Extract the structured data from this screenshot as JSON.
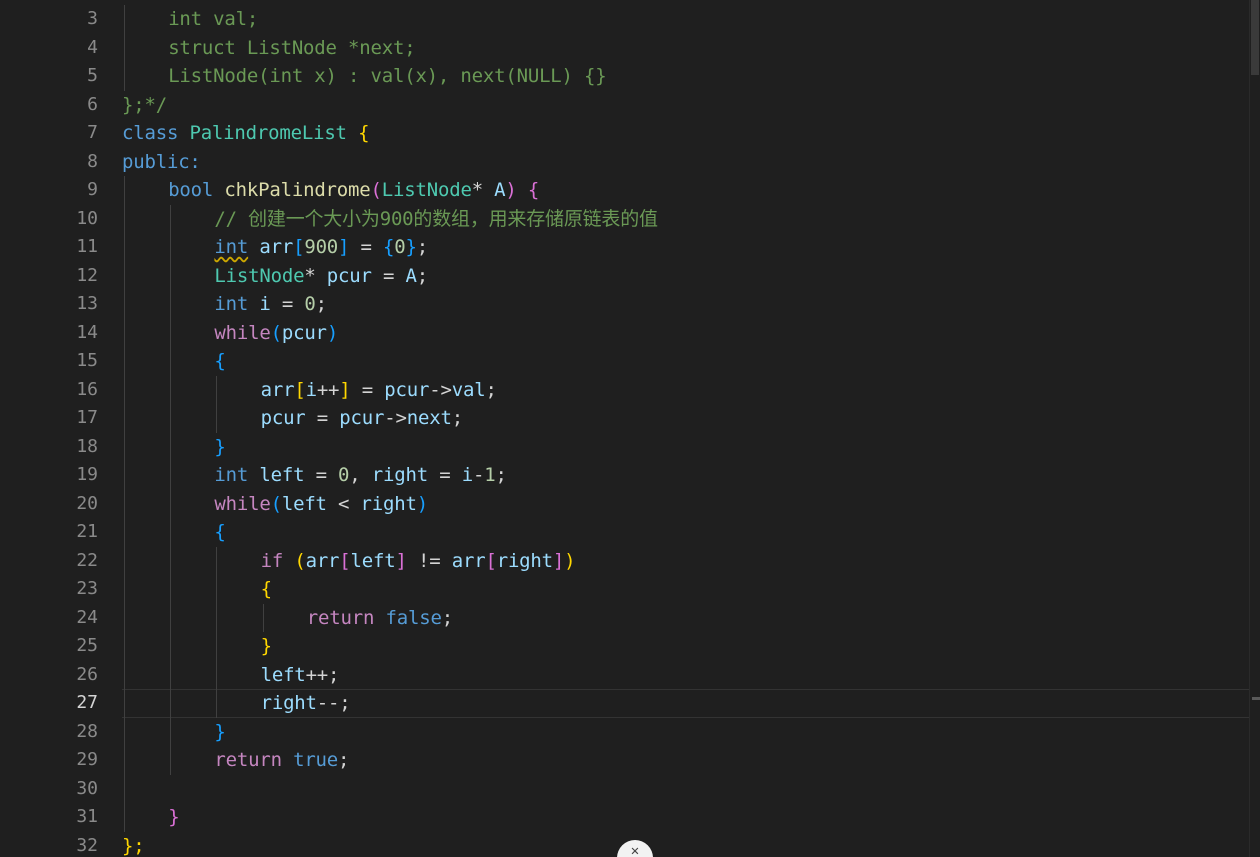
{
  "editor": {
    "lines": [
      {
        "n": "3",
        "segs": [
          [
            "",
            "int val;",
            "cmt"
          ]
        ]
      },
      {
        "n": "4",
        "segs": [
          [
            "",
            "struct ListNode *next;",
            "cmt"
          ]
        ]
      },
      {
        "n": "5",
        "segs": [
          [
            "",
            "ListNode(int x) : val(x), next(NULL) {}",
            "cmt"
          ]
        ]
      },
      {
        "n": "6",
        "segs": [
          [
            "",
            "};*/",
            "cmt"
          ]
        ]
      },
      {
        "n": "7",
        "segs": [
          [
            "",
            "class",
            "kw"
          ],
          [
            "",
            " ",
            ""
          ],
          [
            "",
            "PalindromeList",
            "type"
          ],
          [
            "",
            " ",
            ""
          ],
          [
            "",
            "{",
            "b1"
          ]
        ]
      },
      {
        "n": "8",
        "segs": [
          [
            "",
            "public:",
            "kw"
          ]
        ]
      },
      {
        "n": "9",
        "segs": [
          [
            "",
            "bool",
            "kw"
          ],
          [
            "",
            " ",
            ""
          ],
          [
            "",
            "chkPalindrome",
            "fn"
          ],
          [
            "",
            "(",
            "b2"
          ],
          [
            "",
            "ListNode",
            "type"
          ],
          [
            "",
            "* ",
            ""
          ],
          [
            "",
            "A",
            "var"
          ],
          [
            "",
            ")",
            "b2"
          ],
          [
            "",
            " ",
            ""
          ],
          [
            "",
            "{",
            "b2"
          ]
        ]
      },
      {
        "n": "10",
        "segs": [
          [
            "",
            "// 创建一个大小为900的数组，用来存储原链表的值",
            "cmt"
          ]
        ]
      },
      {
        "n": "11",
        "segs": [
          [
            "",
            "int",
            "kw squig"
          ],
          [
            "",
            " ",
            ""
          ],
          [
            "",
            "arr",
            "var"
          ],
          [
            "",
            "[",
            "b3"
          ],
          [
            "",
            "900",
            "num"
          ],
          [
            "",
            "]",
            "b3"
          ],
          [
            "",
            " = ",
            ""
          ],
          [
            "",
            "{",
            "b3"
          ],
          [
            "",
            "0",
            "num"
          ],
          [
            "",
            "}",
            "b3"
          ],
          [
            "",
            ";",
            ""
          ]
        ]
      },
      {
        "n": "12",
        "segs": [
          [
            "",
            "ListNode",
            "type"
          ],
          [
            "",
            "* ",
            ""
          ],
          [
            "",
            "pcur",
            "var"
          ],
          [
            "",
            " = ",
            ""
          ],
          [
            "",
            "A",
            "var"
          ],
          [
            "",
            ";",
            ""
          ]
        ]
      },
      {
        "n": "13",
        "segs": [
          [
            "",
            "int",
            "kw"
          ],
          [
            "",
            " ",
            ""
          ],
          [
            "",
            "i",
            "var"
          ],
          [
            "",
            " = ",
            ""
          ],
          [
            "",
            "0",
            "num"
          ],
          [
            "",
            ";",
            ""
          ]
        ]
      },
      {
        "n": "14",
        "segs": [
          [
            "",
            "while",
            "ctl"
          ],
          [
            "",
            "(",
            "b3"
          ],
          [
            "",
            "pcur",
            "var"
          ],
          [
            "",
            ")",
            "b3"
          ]
        ]
      },
      {
        "n": "15",
        "segs": [
          [
            "",
            "{",
            "b3"
          ]
        ]
      },
      {
        "n": "16",
        "segs": [
          [
            "",
            "arr",
            "var"
          ],
          [
            "",
            "[",
            "b1"
          ],
          [
            "",
            "i",
            "var"
          ],
          [
            "",
            "++",
            ""
          ],
          [
            "",
            "]",
            "b1"
          ],
          [
            "",
            " = ",
            ""
          ],
          [
            "",
            "pcur",
            "var"
          ],
          [
            "",
            "->",
            ""
          ],
          [
            "",
            "val",
            "var"
          ],
          [
            "",
            ";",
            ""
          ]
        ]
      },
      {
        "n": "17",
        "segs": [
          [
            "",
            "pcur",
            "var"
          ],
          [
            "",
            " = ",
            ""
          ],
          [
            "",
            "pcur",
            "var"
          ],
          [
            "",
            "->",
            ""
          ],
          [
            "",
            "next",
            "var"
          ],
          [
            "",
            ";",
            ""
          ]
        ]
      },
      {
        "n": "18",
        "segs": [
          [
            "",
            "}",
            "b3"
          ]
        ]
      },
      {
        "n": "19",
        "segs": [
          [
            "",
            "int",
            "kw"
          ],
          [
            "",
            " ",
            ""
          ],
          [
            "",
            "left",
            "var"
          ],
          [
            "",
            " = ",
            ""
          ],
          [
            "",
            "0",
            "num"
          ],
          [
            "",
            ", ",
            ""
          ],
          [
            "",
            "right",
            "var"
          ],
          [
            "",
            " = ",
            ""
          ],
          [
            "",
            "i",
            "var"
          ],
          [
            "",
            "-",
            ""
          ],
          [
            "",
            "1",
            "num"
          ],
          [
            "",
            ";",
            ""
          ]
        ]
      },
      {
        "n": "20",
        "segs": [
          [
            "",
            "while",
            "ctl"
          ],
          [
            "",
            "(",
            "b3"
          ],
          [
            "",
            "left",
            "var"
          ],
          [
            "",
            " < ",
            ""
          ],
          [
            "",
            "right",
            "var"
          ],
          [
            "",
            ")",
            "b3"
          ]
        ]
      },
      {
        "n": "21",
        "segs": [
          [
            "",
            "{",
            "b3"
          ]
        ]
      },
      {
        "n": "22",
        "segs": [
          [
            "",
            "if",
            "ctl"
          ],
          [
            "",
            " ",
            ""
          ],
          [
            "",
            "(",
            "b1"
          ],
          [
            "",
            "arr",
            "var"
          ],
          [
            "",
            "[",
            "b2"
          ],
          [
            "",
            "left",
            "var"
          ],
          [
            "",
            "]",
            "b2"
          ],
          [
            "",
            " != ",
            ""
          ],
          [
            "",
            "arr",
            "var"
          ],
          [
            "",
            "[",
            "b2"
          ],
          [
            "",
            "right",
            "var"
          ],
          [
            "",
            "]",
            "b2"
          ],
          [
            "",
            ")",
            "b1"
          ]
        ]
      },
      {
        "n": "23",
        "segs": [
          [
            "",
            "{",
            "b1"
          ]
        ]
      },
      {
        "n": "24",
        "segs": [
          [
            "",
            "return",
            "ctl"
          ],
          [
            "",
            " ",
            ""
          ],
          [
            "",
            "false",
            "kw"
          ],
          [
            "",
            ";",
            ""
          ]
        ]
      },
      {
        "n": "25",
        "segs": [
          [
            "",
            "}",
            "b1"
          ]
        ]
      },
      {
        "n": "26",
        "segs": [
          [
            "",
            "left",
            "var"
          ],
          [
            "",
            "++;",
            ""
          ]
        ]
      },
      {
        "n": "27",
        "segs": [
          [
            "",
            "right",
            "var"
          ],
          [
            "",
            "--;",
            ""
          ]
        ]
      },
      {
        "n": "28",
        "segs": [
          [
            "",
            "}",
            "b3"
          ]
        ]
      },
      {
        "n": "29",
        "segs": [
          [
            "",
            "return",
            "ctl"
          ],
          [
            "",
            " ",
            ""
          ],
          [
            "",
            "true",
            "kw"
          ],
          [
            "",
            ";",
            ""
          ]
        ]
      },
      {
        "n": "30",
        "segs": []
      },
      {
        "n": "31",
        "segs": [
          [
            "",
            "}",
            "b2"
          ]
        ]
      },
      {
        "n": "32",
        "segs": [
          [
            "",
            "};",
            "b1"
          ]
        ]
      }
    ],
    "indents": [
      1,
      1,
      1,
      0,
      0,
      0,
      1,
      2,
      2,
      2,
      2,
      2,
      2,
      3,
      3,
      2,
      2,
      2,
      2,
      3,
      3,
      4,
      3,
      3,
      3,
      2,
      2,
      1,
      1,
      0
    ],
    "active_line": "27",
    "colors": {
      "background": "#1f1f1f",
      "keyword": "#569cd6",
      "control": "#c586c0",
      "type": "#4ec9b0",
      "function": "#dcdcaa",
      "variable": "#9cdcfe",
      "number": "#b5cea8",
      "comment": "#6a9955"
    }
  }
}
